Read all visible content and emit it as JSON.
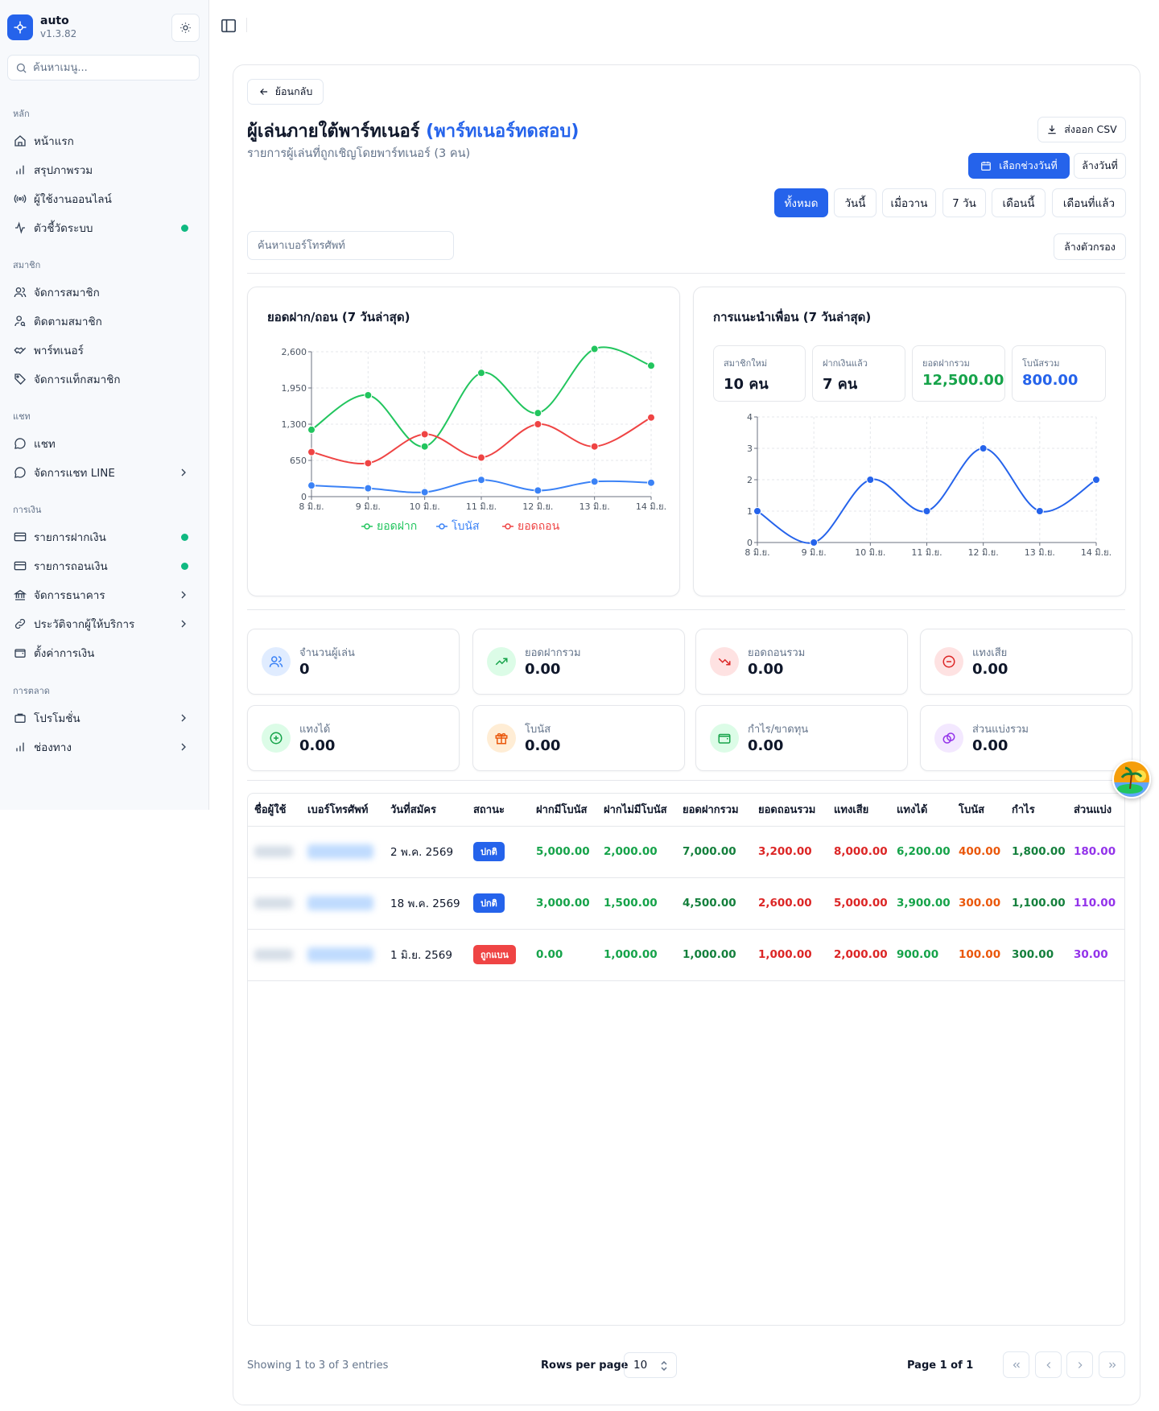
{
  "sidebar": {
    "app_name": "auto",
    "version": "v1.3.82",
    "search_placeholder": "ค้นหาเมนู...",
    "sections": {
      "main": "หลัก",
      "members": "สมาชิก",
      "chat": "แชท",
      "finance": "การเงิน",
      "marketing": "การตลาด"
    },
    "items": {
      "home": "หน้าแรก",
      "overview": "สรุปภาพรวม",
      "online": "ผู้ใช้งานออนไลน์",
      "metrics": "ตัวชี้วัดระบบ",
      "manage_members": "จัดการสมาชิก",
      "track_members": "ติดตามสมาชิก",
      "partner": "พาร์ทเนอร์",
      "member_tags": "จัดการแท็กสมาชิก",
      "chat": "แชท",
      "line_chat": "จัดการแชท LINE",
      "deposits": "รายการฝากเงิน",
      "withdrawals": "รายการถอนเงิน",
      "banks": "จัดการธนาคาร",
      "provider_history": "ประวัติจากผู้ให้บริการ",
      "finance_settings": "ตั้งค่าการเงิน",
      "promotions": "โปรโมชั่น",
      "channels": "ช่องทาง"
    }
  },
  "header": {
    "back_label": "ย้อนกลับ",
    "title": "ผู้เล่นภายใต้พาร์ทเนอร์",
    "partner_name": "(พาร์ทเนอร์ทดสอบ)",
    "subtitle": "รายการผู้เล่นที่ถูกเชิญโดยพาร์ทเนอร์ (3 คน)",
    "export_label": "ส่งออก CSV",
    "date_range_label": "เลือกช่วงวันที่",
    "clear_date_label": "ล้างวันที่",
    "filters": [
      "ทั้งหมด",
      "วันนี้",
      "เมื่อวาน",
      "7 วัน",
      "เดือนนี้",
      "เดือนที่แล้ว"
    ],
    "active_filter": "ทั้งหมด",
    "phone_search_placeholder": "ค้นหาเบอร์โทรศัพท์",
    "clear_filters_label": "ล้างตัวกรอง"
  },
  "colors": {
    "primary": "#2563eb",
    "deposit": "#22c55e",
    "bonus": "#3b82f6",
    "withdraw": "#ef4444",
    "status_normal": "#2563eb",
    "status_banned": "#ef4444"
  },
  "chart_data": [
    {
      "type": "line",
      "title": "ยอดฝาก/ถอน (7 วันล่าสุด)",
      "categories": [
        "8 มิ.ย.",
        "9 มิ.ย.",
        "10 มิ.ย.",
        "11 มิ.ย.",
        "12 มิ.ย.",
        "13 มิ.ย.",
        "14 มิ.ย."
      ],
      "ylim": [
        0,
        2600
      ],
      "yticks": [
        "0",
        "650",
        "1,300",
        "1,950",
        "2,600"
      ],
      "grid": true,
      "legend": "bottom",
      "series": [
        {
          "name": "ยอดฝาก",
          "color": "#22c55e",
          "values": [
            1200,
            1820,
            900,
            2220,
            1500,
            2650,
            2350
          ]
        },
        {
          "name": "โบนัส",
          "color": "#3b82f6",
          "values": [
            200,
            150,
            80,
            300,
            110,
            270,
            250
          ]
        },
        {
          "name": "ยอดถอน",
          "color": "#ef4444",
          "values": [
            800,
            600,
            1120,
            700,
            1300,
            900,
            1420
          ]
        }
      ]
    },
    {
      "type": "line",
      "title": "การแนะนำเพื่อน (7 วันล่าสุด)",
      "categories": [
        "8 มิ.ย.",
        "9 มิ.ย.",
        "10 มิ.ย.",
        "11 มิ.ย.",
        "12 มิ.ย.",
        "13 มิ.ย.",
        "14 มิ.ย."
      ],
      "ylim": [
        0,
        4
      ],
      "yticks": [
        "0",
        "1",
        "2",
        "3",
        "4"
      ],
      "grid": true,
      "series": [
        {
          "color": "#2563eb",
          "values": [
            1,
            0,
            2,
            1,
            3,
            1,
            2
          ]
        }
      ],
      "summary": [
        {
          "label": "สมาชิกใหม่",
          "value": "10 คน",
          "color": "#0f172a"
        },
        {
          "label": "ฝากเงินแล้ว",
          "value": "7 คน",
          "color": "#0f172a"
        },
        {
          "label": "ยอดฝากรวม",
          "value": "12,500.00",
          "color": "#16a34a"
        },
        {
          "label": "โบนัสรวม",
          "value": "800.00",
          "color": "#2563eb"
        }
      ]
    }
  ],
  "stats": [
    {
      "label": "จำนวนผู้เล่น",
      "value": "0",
      "icon": "users-icon",
      "bg": "#e0ecff",
      "fg": "#3b82f6"
    },
    {
      "label": "ยอดฝากรวม",
      "value": "0.00",
      "icon": "trending-up-icon",
      "bg": "#dcfce7",
      "fg": "#16a34a"
    },
    {
      "label": "ยอดถอนรวม",
      "value": "0.00",
      "icon": "trending-down-icon",
      "bg": "#fee2e2",
      "fg": "#dc2626"
    },
    {
      "label": "แทงเสีย",
      "value": "0.00",
      "icon": "minus-circle-icon",
      "bg": "#fee2e2",
      "fg": "#dc2626"
    },
    {
      "label": "แทงได้",
      "value": "0.00",
      "icon": "plus-circle-icon",
      "bg": "#dcfce7",
      "fg": "#16a34a"
    },
    {
      "label": "โบนัส",
      "value": "0.00",
      "icon": "gift-icon",
      "bg": "#ffedd5",
      "fg": "#ea580c"
    },
    {
      "label": "กำไร/ขาดทุน",
      "value": "0.00",
      "icon": "wallet-icon",
      "bg": "#dcfce7",
      "fg": "#16a34a"
    },
    {
      "label": "ส่วนแบ่งรวม",
      "value": "0.00",
      "icon": "coins-icon",
      "bg": "#f3e8ff",
      "fg": "#9333ea"
    }
  ],
  "table": {
    "headers": [
      "ชื่อผู้ใช้",
      "เบอร์โทรศัพท์",
      "วันที่สมัคร",
      "สถานะ",
      "ฝากมีโบนัส",
      "ฝากไม่มีโบนัส",
      "ยอดฝากรวม",
      "ยอดถอนรวม",
      "แทงเสีย",
      "แทงได้",
      "โบนัส",
      "กำไร",
      "ส่วนแบ่ง"
    ],
    "rows": [
      {
        "date": "2 พ.ค. 2569",
        "status": "ปกติ",
        "status_kind": "normal",
        "dep_bonus": "5,000.00",
        "dep_nobonus": "2,000.00",
        "dep_total": "7,000.00",
        "wd_total": "3,200.00",
        "lose": "8,000.00",
        "win": "6,200.00",
        "bonus": "400.00",
        "profit": "1,800.00",
        "share": "180.00"
      },
      {
        "date": "18 พ.ค. 2569",
        "status": "ปกติ",
        "status_kind": "normal",
        "dep_bonus": "3,000.00",
        "dep_nobonus": "1,500.00",
        "dep_total": "4,500.00",
        "wd_total": "2,600.00",
        "lose": "5,000.00",
        "win": "3,900.00",
        "bonus": "300.00",
        "profit": "1,100.00",
        "share": "110.00"
      },
      {
        "date": "1 มิ.ย. 2569",
        "status": "ถูกแบน",
        "status_kind": "banned",
        "dep_bonus": "0.00",
        "dep_nobonus": "1,000.00",
        "dep_total": "1,000.00",
        "wd_total": "1,000.00",
        "lose": "2,000.00",
        "win": "900.00",
        "bonus": "100.00",
        "profit": "300.00",
        "share": "30.00"
      }
    ]
  },
  "footer": {
    "showing": "Showing 1 to 3 of 3 entries",
    "rows_per_page_label": "Rows per page",
    "rows_per_page": "10",
    "page_info": "Page 1 of 1"
  }
}
